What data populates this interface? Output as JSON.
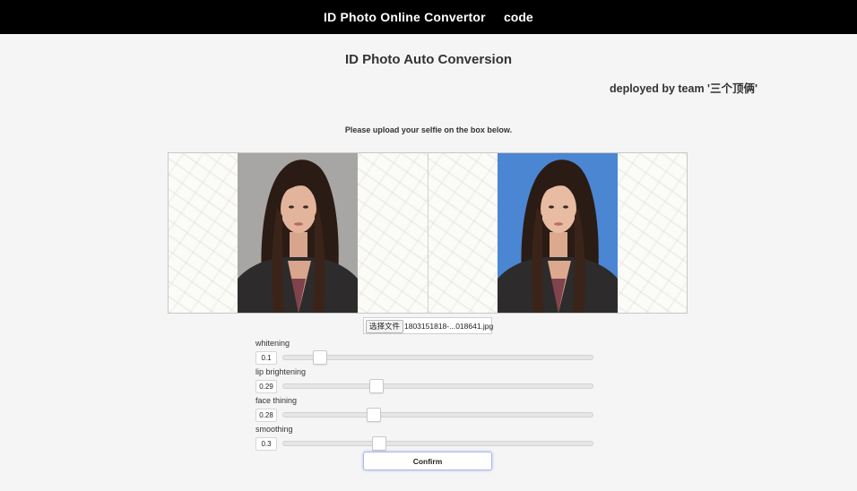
{
  "nav": {
    "brand": "ID Photo Online Convertor",
    "code_link": "code"
  },
  "page": {
    "title": "ID Photo Auto Conversion",
    "deployed_by": "deployed by team '三个顶俩'",
    "instruction": "Please upload your selfie on the box below."
  },
  "images": {
    "original_bg": "#a8a6a4",
    "converted_bg": "#4b86d2"
  },
  "file_input": {
    "button_label": "选择文件",
    "file_name": "1803151818-...018641.jpg"
  },
  "sliders": [
    {
      "label": "whitening",
      "value": "0.1",
      "level": 0.1
    },
    {
      "label": "lip brightening",
      "value": "0.29",
      "level": 0.29
    },
    {
      "label": "face thining",
      "value": "0.28",
      "level": 0.28
    },
    {
      "label": "smoothing",
      "value": "0.3",
      "level": 0.3
    }
  ],
  "confirm_label": "Confirm"
}
